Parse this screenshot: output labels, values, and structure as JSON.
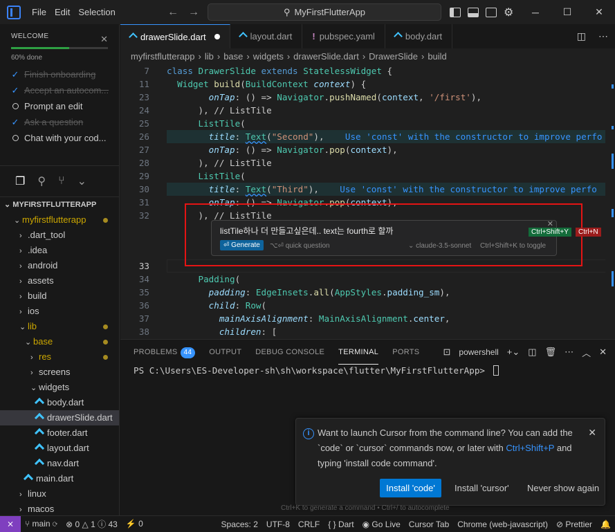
{
  "titlebar": {
    "menu": [
      "File",
      "Edit",
      "Selection"
    ],
    "search": "MyFirstFlutterApp"
  },
  "welcome": {
    "title": "WELCOME",
    "progress_text": "60% done",
    "progress": 0.6,
    "steps": [
      {
        "label": "Finish onboarding",
        "done": true
      },
      {
        "label": "Accept an autocom...",
        "done": true
      },
      {
        "label": "Prompt an edit",
        "done": false
      },
      {
        "label": "Ask a question",
        "done": true
      },
      {
        "label": "Chat with your cod...",
        "done": false
      }
    ]
  },
  "explorer": {
    "root": "MYFIRSTFLUTTERAPP",
    "items": [
      {
        "label": "myfirstflutterapp",
        "type": "folder-open",
        "depth": 0,
        "modified": true
      },
      {
        "label": ".dart_tool",
        "type": "folder",
        "depth": 1
      },
      {
        "label": ".idea",
        "type": "folder",
        "depth": 1
      },
      {
        "label": "android",
        "type": "folder",
        "depth": 1
      },
      {
        "label": "assets",
        "type": "folder",
        "depth": 1
      },
      {
        "label": "build",
        "type": "folder",
        "depth": 1
      },
      {
        "label": "ios",
        "type": "folder",
        "depth": 1
      },
      {
        "label": "lib",
        "type": "folder-open",
        "depth": 1,
        "modified": true
      },
      {
        "label": "base",
        "type": "folder-open",
        "depth": 2,
        "modified": true
      },
      {
        "label": "res",
        "type": "folder",
        "depth": 3,
        "modified": true
      },
      {
        "label": "screens",
        "type": "folder",
        "depth": 3
      },
      {
        "label": "widgets",
        "type": "folder-open",
        "depth": 3
      },
      {
        "label": "body.dart",
        "type": "dart",
        "depth": 4
      },
      {
        "label": "drawerSlide.dart",
        "type": "dart",
        "depth": 4,
        "selected": true
      },
      {
        "label": "footer.dart",
        "type": "dart",
        "depth": 4
      },
      {
        "label": "layout.dart",
        "type": "dart",
        "depth": 4
      },
      {
        "label": "nav.dart",
        "type": "dart",
        "depth": 4
      },
      {
        "label": "main.dart",
        "type": "dart",
        "depth": 2
      },
      {
        "label": "linux",
        "type": "folder",
        "depth": 1
      },
      {
        "label": "macos",
        "type": "folder",
        "depth": 1
      }
    ]
  },
  "tabs": [
    {
      "label": "drawerSlide.dart",
      "icon": "dart",
      "active": true,
      "dirty": true
    },
    {
      "label": "layout.dart",
      "icon": "dart"
    },
    {
      "label": "pubspec.yaml",
      "icon": "yaml"
    },
    {
      "label": "body.dart",
      "icon": "dart"
    }
  ],
  "breadcrumb": [
    "myfirstflutterapp",
    "lib",
    "base",
    "widgets",
    "drawerSlide.dart",
    "DrawerSlide",
    "build"
  ],
  "code_lines": [
    {
      "n": "7",
      "html": "<span class='kw'>class</span> <span class='cls'>DrawerSlide</span> <span class='kw'>extends</span> <span class='cls'>StatelessWidget</span> {"
    },
    {
      "n": "11",
      "html": "  <span class='cls'>Widget</span> <span class='fn'>build</span>(<span class='cls'>BuildContext</span> <span class='prm'><i>context</i></span>) {"
    },
    {
      "n": "23",
      "html": "        <span class='prop'><i>onTap</i></span>: () => <span class='cls'>Navigator</span>.<span class='fn'>pushNamed</span>(<span class='prm'>context</span>, <span class='str'>'/first'</span>),"
    },
    {
      "n": "24",
      "html": "      ), <span class='cmt'>// ListTile</span>"
    },
    {
      "n": "25",
      "html": "      <span class='cls'>ListTile</span>("
    },
    {
      "n": "26",
      "html": "        <span class='prop'><i>title</i></span>: <span class='cls squig'>Text</span>(<span class='str'>\"Second\"</span>),    <span class='hint'>Use 'const' with the constructor to improve perfo</span>",
      "hl": true
    },
    {
      "n": "27",
      "html": "        <span class='prop'><i>onTap</i></span>: () => <span class='cls'>Navigator</span>.<span class='fn'>pop</span>(<span class='prm'>context</span>),"
    },
    {
      "n": "28",
      "html": "      ), <span class='cmt'>// ListTile</span>"
    },
    {
      "n": "29",
      "html": "      <span class='cls'>ListTile</span>("
    },
    {
      "n": "30",
      "html": "        <span class='prop'><i>title</i></span>: <span class='cls squig'>Text</span>(<span class='str'>\"Third\"</span>),    <span class='hint'>Use 'const' with the constructor to improve perfo</span>",
      "hl": true
    },
    {
      "n": "31",
      "html": "        <span class='prop'><i>onTap</i></span>: () => <span class='cls'>Navigator</span>.<span class='fn'>pop</span>(<span class='prm'>context</span>),"
    },
    {
      "n": "32",
      "html": "      ), <span class='cmt'>// ListTile</span>"
    }
  ],
  "code_lines_after": [
    {
      "n": "33",
      "html": ""
    },
    {
      "n": "34",
      "html": "      <span class='cls'>Padding</span>("
    },
    {
      "n": "35",
      "html": "        <span class='prop'><i>padding</i></span>: <span class='cls'>EdgeInsets</span>.<span class='fn'>all</span>(<span class='cls'>AppStyles</span>.<span class='prop'>padding_sm</span>),"
    },
    {
      "n": "36",
      "html": "        <span class='prop'><i>child</i></span>: <span class='cls'>Row</span>("
    },
    {
      "n": "37",
      "html": "          <span class='prop'><i>mainAxisAlignment</i></span>: <span class='cls'>MainAxisAlignment</span>.<span class='prop'>center</span>,"
    },
    {
      "n": "38",
      "html": "          <span class='prop'><i>children</i></span>: ["
    }
  ],
  "inline_chat": {
    "prompt": "listTile하나 더 만들고싶은데.. text는 fourth로 할까",
    "generate": "Generate",
    "quick_question": "quick question",
    "model": "claude-3.5-sonnet",
    "toggle_hint": "Ctrl+Shift+K to toggle",
    "accept_key": "Ctrl+Shift+Y",
    "reject_key": "Ctrl+N"
  },
  "panel": {
    "tabs": [
      "PROBLEMS",
      "OUTPUT",
      "DEBUG CONSOLE",
      "TERMINAL",
      "PORTS"
    ],
    "problems_count": "44",
    "shell": "powershell",
    "prompt": "PS C:\\Users\\ES-Developer-sh\\sh\\workspace\\flutter\\MyFirstFlutterApp> "
  },
  "notification": {
    "text_before": "Want to launch Cursor from the command line? You can add the `code` or `cursor` commands now, or later with ",
    "link": "Ctrl+Shift+P",
    "text_after": " and typing 'install code command'.",
    "primary": "Install 'code'",
    "secondary": "Install 'cursor'",
    "tertiary": "Never show again"
  },
  "bottom_hint": "Ctrl+K to generate a command • Ctrl+/ to autocomplete",
  "status": {
    "branch": "main",
    "errors": "0",
    "warnings": "1",
    "infos": "43",
    "ports": "0",
    "spaces": "Spaces: 2",
    "encoding": "UTF-8",
    "eol": "CRLF",
    "language": "Dart",
    "golive": "Go Live",
    "cursortab": "Cursor Tab",
    "device": "Chrome (web-javascript)",
    "prettier": "Prettier"
  }
}
